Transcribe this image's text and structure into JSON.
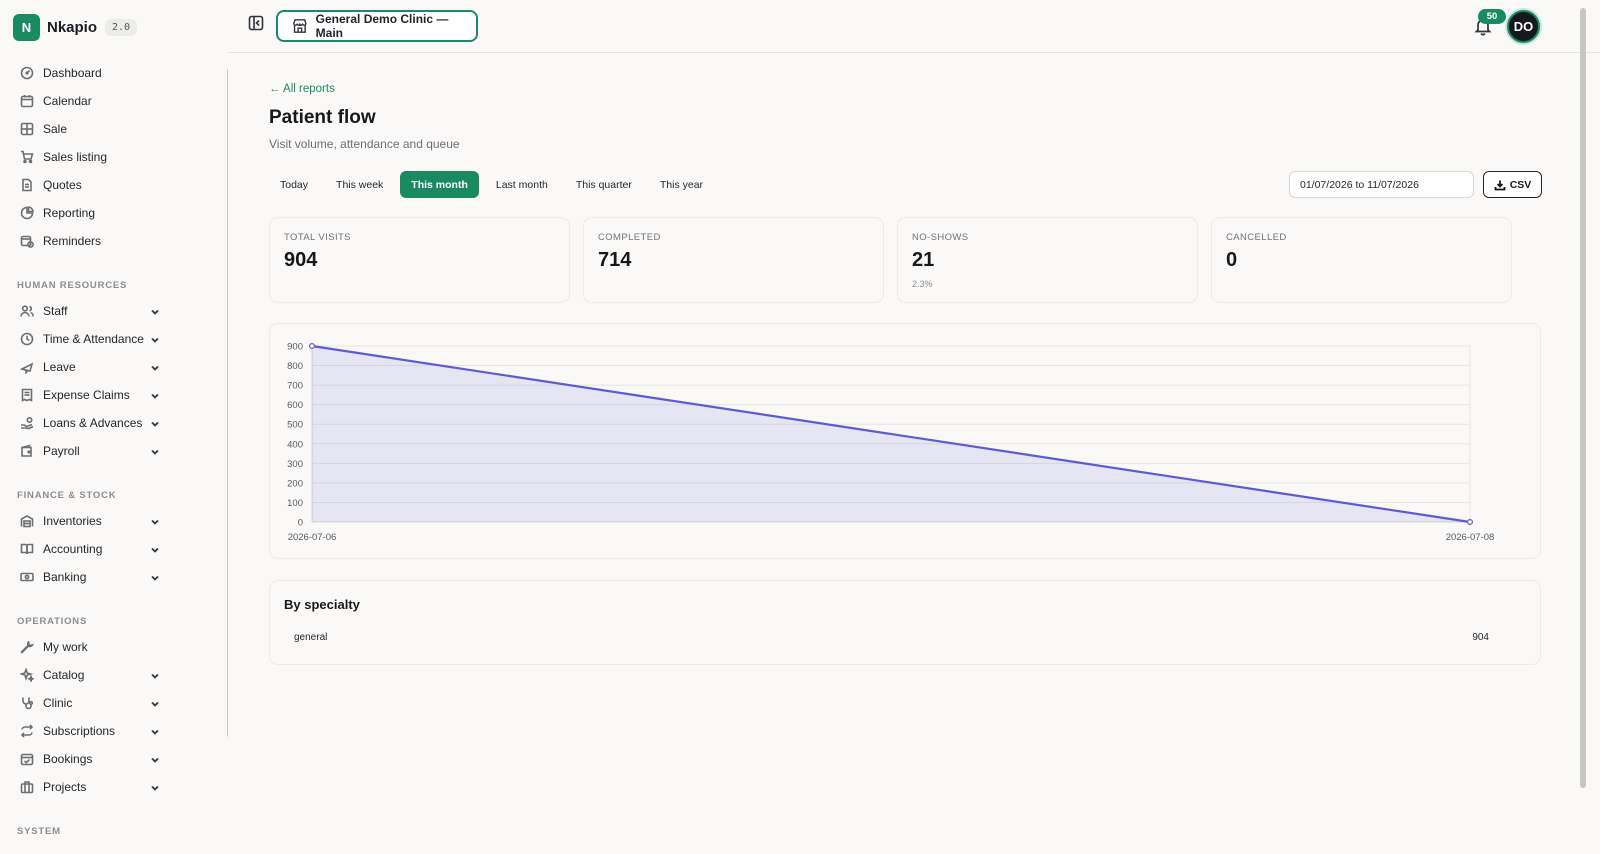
{
  "app": {
    "name": "Nkapio",
    "version": "2.0",
    "logo_letter": "N",
    "accent": "#1a8a63"
  },
  "nav": {
    "main": [
      {
        "label": "Dashboard",
        "icon": "dashboard-icon"
      },
      {
        "label": "Calendar",
        "icon": "calendar-icon"
      },
      {
        "label": "Sale",
        "icon": "sale-icon"
      },
      {
        "label": "Sales listing",
        "icon": "cart-icon"
      },
      {
        "label": "Quotes",
        "icon": "document-icon"
      },
      {
        "label": "Reporting",
        "icon": "pie-chart-icon"
      },
      {
        "label": "Reminders",
        "icon": "calendar-clock-icon"
      }
    ],
    "hr_label": "HUMAN RESOURCES",
    "hr": [
      {
        "label": "Staff",
        "icon": "users-icon"
      },
      {
        "label": "Time & Attendance",
        "icon": "clock-icon"
      },
      {
        "label": "Leave",
        "icon": "plane-icon"
      },
      {
        "label": "Expense Claims",
        "icon": "receipt-icon"
      },
      {
        "label": "Loans & Advances",
        "icon": "hand-coins-icon"
      },
      {
        "label": "Payroll",
        "icon": "wallet-icon"
      }
    ],
    "finance_label": "FINANCE & STOCK",
    "finance": [
      {
        "label": "Inventories",
        "icon": "warehouse-icon"
      },
      {
        "label": "Accounting",
        "icon": "book-icon"
      },
      {
        "label": "Banking",
        "icon": "banknote-icon"
      }
    ],
    "ops_label": "OPERATIONS",
    "ops": [
      {
        "label": "My work",
        "icon": "wrench-icon"
      },
      {
        "label": "Catalog",
        "icon": "sparkles-icon"
      },
      {
        "label": "Clinic",
        "icon": "stethoscope-icon"
      },
      {
        "label": "Subscriptions",
        "icon": "repeat-icon"
      },
      {
        "label": "Bookings",
        "icon": "calendar-check-icon"
      },
      {
        "label": "Projects",
        "icon": "briefcase-icon"
      }
    ],
    "system_label": "SYSTEM"
  },
  "topbar": {
    "clinic": "General Demo Clinic — Main",
    "notifications": "50",
    "avatar": "DO"
  },
  "page": {
    "back": "← All reports",
    "title": "Patient flow",
    "subtitle": "Visit volume, attendance and queue",
    "ranges": [
      "Today",
      "This week",
      "This month",
      "Last month",
      "This quarter",
      "This year"
    ],
    "active_range": "This month",
    "date_range": "01/07/2026 to 11/07/2026",
    "csv": "CSV"
  },
  "stats": [
    {
      "label": "TOTAL VISITS",
      "value": "904",
      "note": ""
    },
    {
      "label": "COMPLETED",
      "value": "714",
      "note": ""
    },
    {
      "label": "NO-SHOWS",
      "value": "21",
      "note": "2.3%"
    },
    {
      "label": "CANCELLED",
      "value": "0",
      "note": ""
    }
  ],
  "chart_data": {
    "type": "area",
    "x": [
      "2026-07-06",
      "2026-07-08"
    ],
    "series": [
      {
        "values": [
          900,
          0
        ],
        "color": "#5b5bd6"
      }
    ],
    "ylim": [
      0,
      900
    ],
    "yticks": [
      0,
      100,
      200,
      300,
      400,
      500,
      600,
      700,
      800,
      900
    ],
    "grid": true
  },
  "specialty": {
    "title": "By specialty",
    "rows": [
      {
        "name": "general",
        "count": "904"
      }
    ]
  }
}
